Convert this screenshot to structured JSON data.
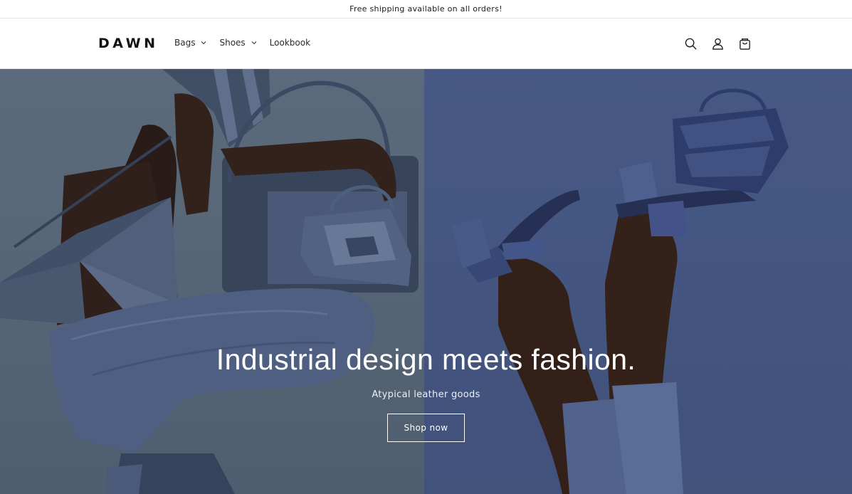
{
  "announcement": {
    "text": "Free shipping available on all orders!"
  },
  "header": {
    "logo": "DAWN",
    "nav": [
      {
        "label": "Bags",
        "has_dropdown": true
      },
      {
        "label": "Shoes",
        "has_dropdown": true
      },
      {
        "label": "Lookbook",
        "has_dropdown": false
      }
    ],
    "icons": [
      "search-icon",
      "account-icon",
      "cart-icon"
    ]
  },
  "hero": {
    "title": "Industrial design meets fashion.",
    "subtitle": "Atypical leather goods",
    "cta_label": "Shop now",
    "colors": {
      "left_panel": "#667889",
      "right_panel": "#4e6294",
      "text": "#ffffff"
    }
  }
}
